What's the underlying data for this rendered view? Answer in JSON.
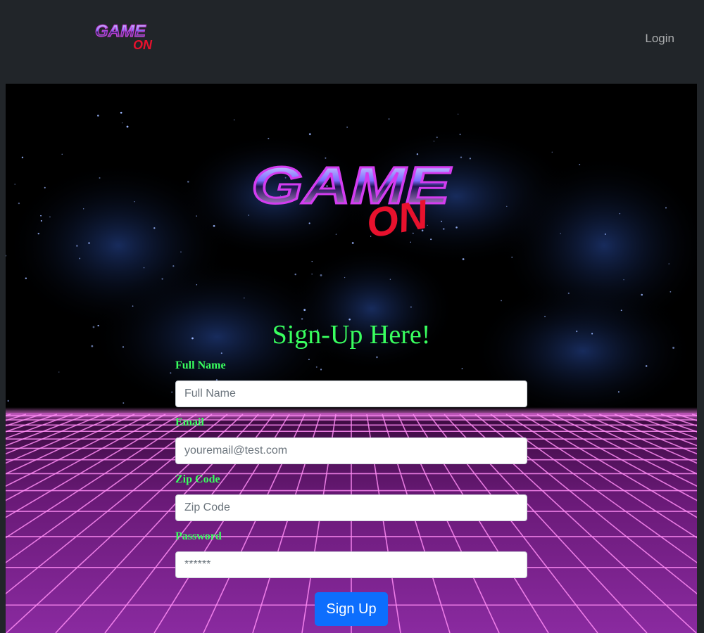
{
  "navbar": {
    "logo": {
      "line1": "GAME",
      "line2": "ON"
    },
    "login_label": "Login"
  },
  "hero": {
    "logo": {
      "line1": "GAME",
      "line2": "ON"
    },
    "title": "Sign-Up Here!"
  },
  "form": {
    "fields": [
      {
        "label": "Full Name",
        "placeholder": "Full Name",
        "value": "",
        "type": "text"
      },
      {
        "label": "Email",
        "placeholder": "youremail@test.com",
        "value": "",
        "type": "email"
      },
      {
        "label": "Zip Code",
        "placeholder": "Zip Code",
        "value": "",
        "type": "text"
      },
      {
        "label": "Password",
        "placeholder": "******",
        "value": "",
        "type": "password"
      }
    ],
    "submit_label": "Sign Up"
  },
  "colors": {
    "navbar_bg": "#212529",
    "label_green": "#39ff5f",
    "grid_magenta": "#ff5cf0",
    "button_blue": "#0d6efd",
    "logo_red": "#e8112d"
  }
}
